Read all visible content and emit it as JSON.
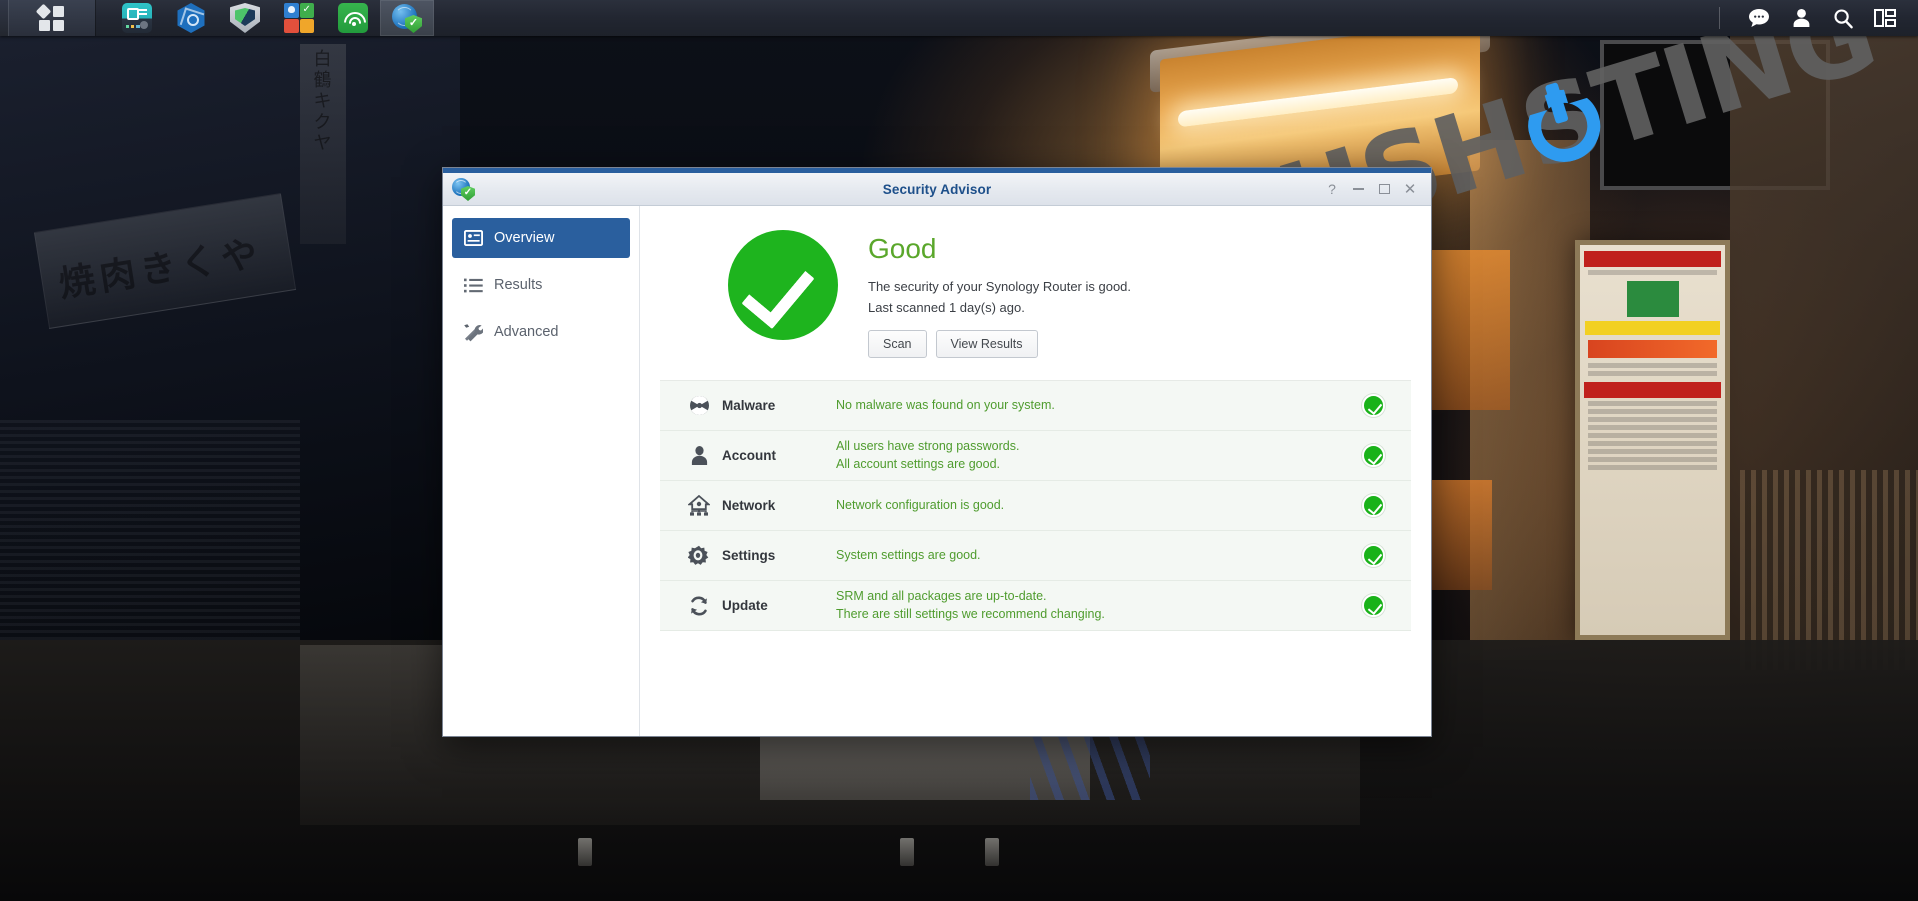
{
  "taskbar": {
    "main_menu_label": "main-menu",
    "apps": [
      {
        "name": "router-app",
        "icon": "router-icon"
      },
      {
        "name": "network-center-app",
        "icon": "hexagon-network-icon"
      },
      {
        "name": "threat-prevention-app",
        "icon": "shield-map-icon"
      },
      {
        "name": "control-panel-app",
        "icon": "control-panel-icon"
      },
      {
        "name": "wifi-connect-app",
        "icon": "wifi-icon"
      },
      {
        "name": "security-advisor-app",
        "icon": "security-advisor-icon"
      }
    ],
    "right_icons": [
      {
        "name": "notifications-icon",
        "glyph": "speech-bubble"
      },
      {
        "name": "user-account-icon",
        "glyph": "person"
      },
      {
        "name": "search-icon",
        "glyph": "magnifier"
      },
      {
        "name": "widgets-icon",
        "glyph": "panels"
      }
    ]
  },
  "window": {
    "title": "Security Advisor",
    "controls": {
      "help": "?",
      "minimize": "–",
      "maximize": "□",
      "close": "✕"
    }
  },
  "sidebar": {
    "items": [
      {
        "label": "Overview",
        "icon": "overview-card-icon",
        "active": true
      },
      {
        "label": "Results",
        "icon": "list-icon",
        "active": false
      },
      {
        "label": "Advanced",
        "icon": "tools-icon",
        "active": false
      }
    ]
  },
  "overview": {
    "status": "Good",
    "status_color": "#5aa72b",
    "description": "The security of your Synology Router is good.",
    "last_scanned": "Last scanned 1 day(s) ago.",
    "buttons": {
      "scan": "Scan",
      "view_results": "View Results"
    }
  },
  "results": [
    {
      "name": "Malware",
      "icon": "malware-icon",
      "messages": [
        "No malware was found on your system."
      ],
      "status": "ok"
    },
    {
      "name": "Account",
      "icon": "account-icon",
      "messages": [
        "All users have strong passwords.",
        "All account settings are good."
      ],
      "status": "ok"
    },
    {
      "name": "Network",
      "icon": "network-icon",
      "messages": [
        "Network configuration is good."
      ],
      "status": "ok"
    },
    {
      "name": "Settings",
      "icon": "settings-gear-icon",
      "messages": [
        "System settings are good."
      ],
      "status": "ok"
    },
    {
      "name": "Update",
      "icon": "update-refresh-icon",
      "messages": [
        "SRM and all packages are up-to-date.",
        "There are still settings we recommend changing."
      ],
      "status": "ok"
    }
  ],
  "watermark": {
    "part1": "MARIUSH",
    "part2": "STING",
    "accent_color": "#2e9bf0",
    "text_color": "#5f5f5f"
  }
}
